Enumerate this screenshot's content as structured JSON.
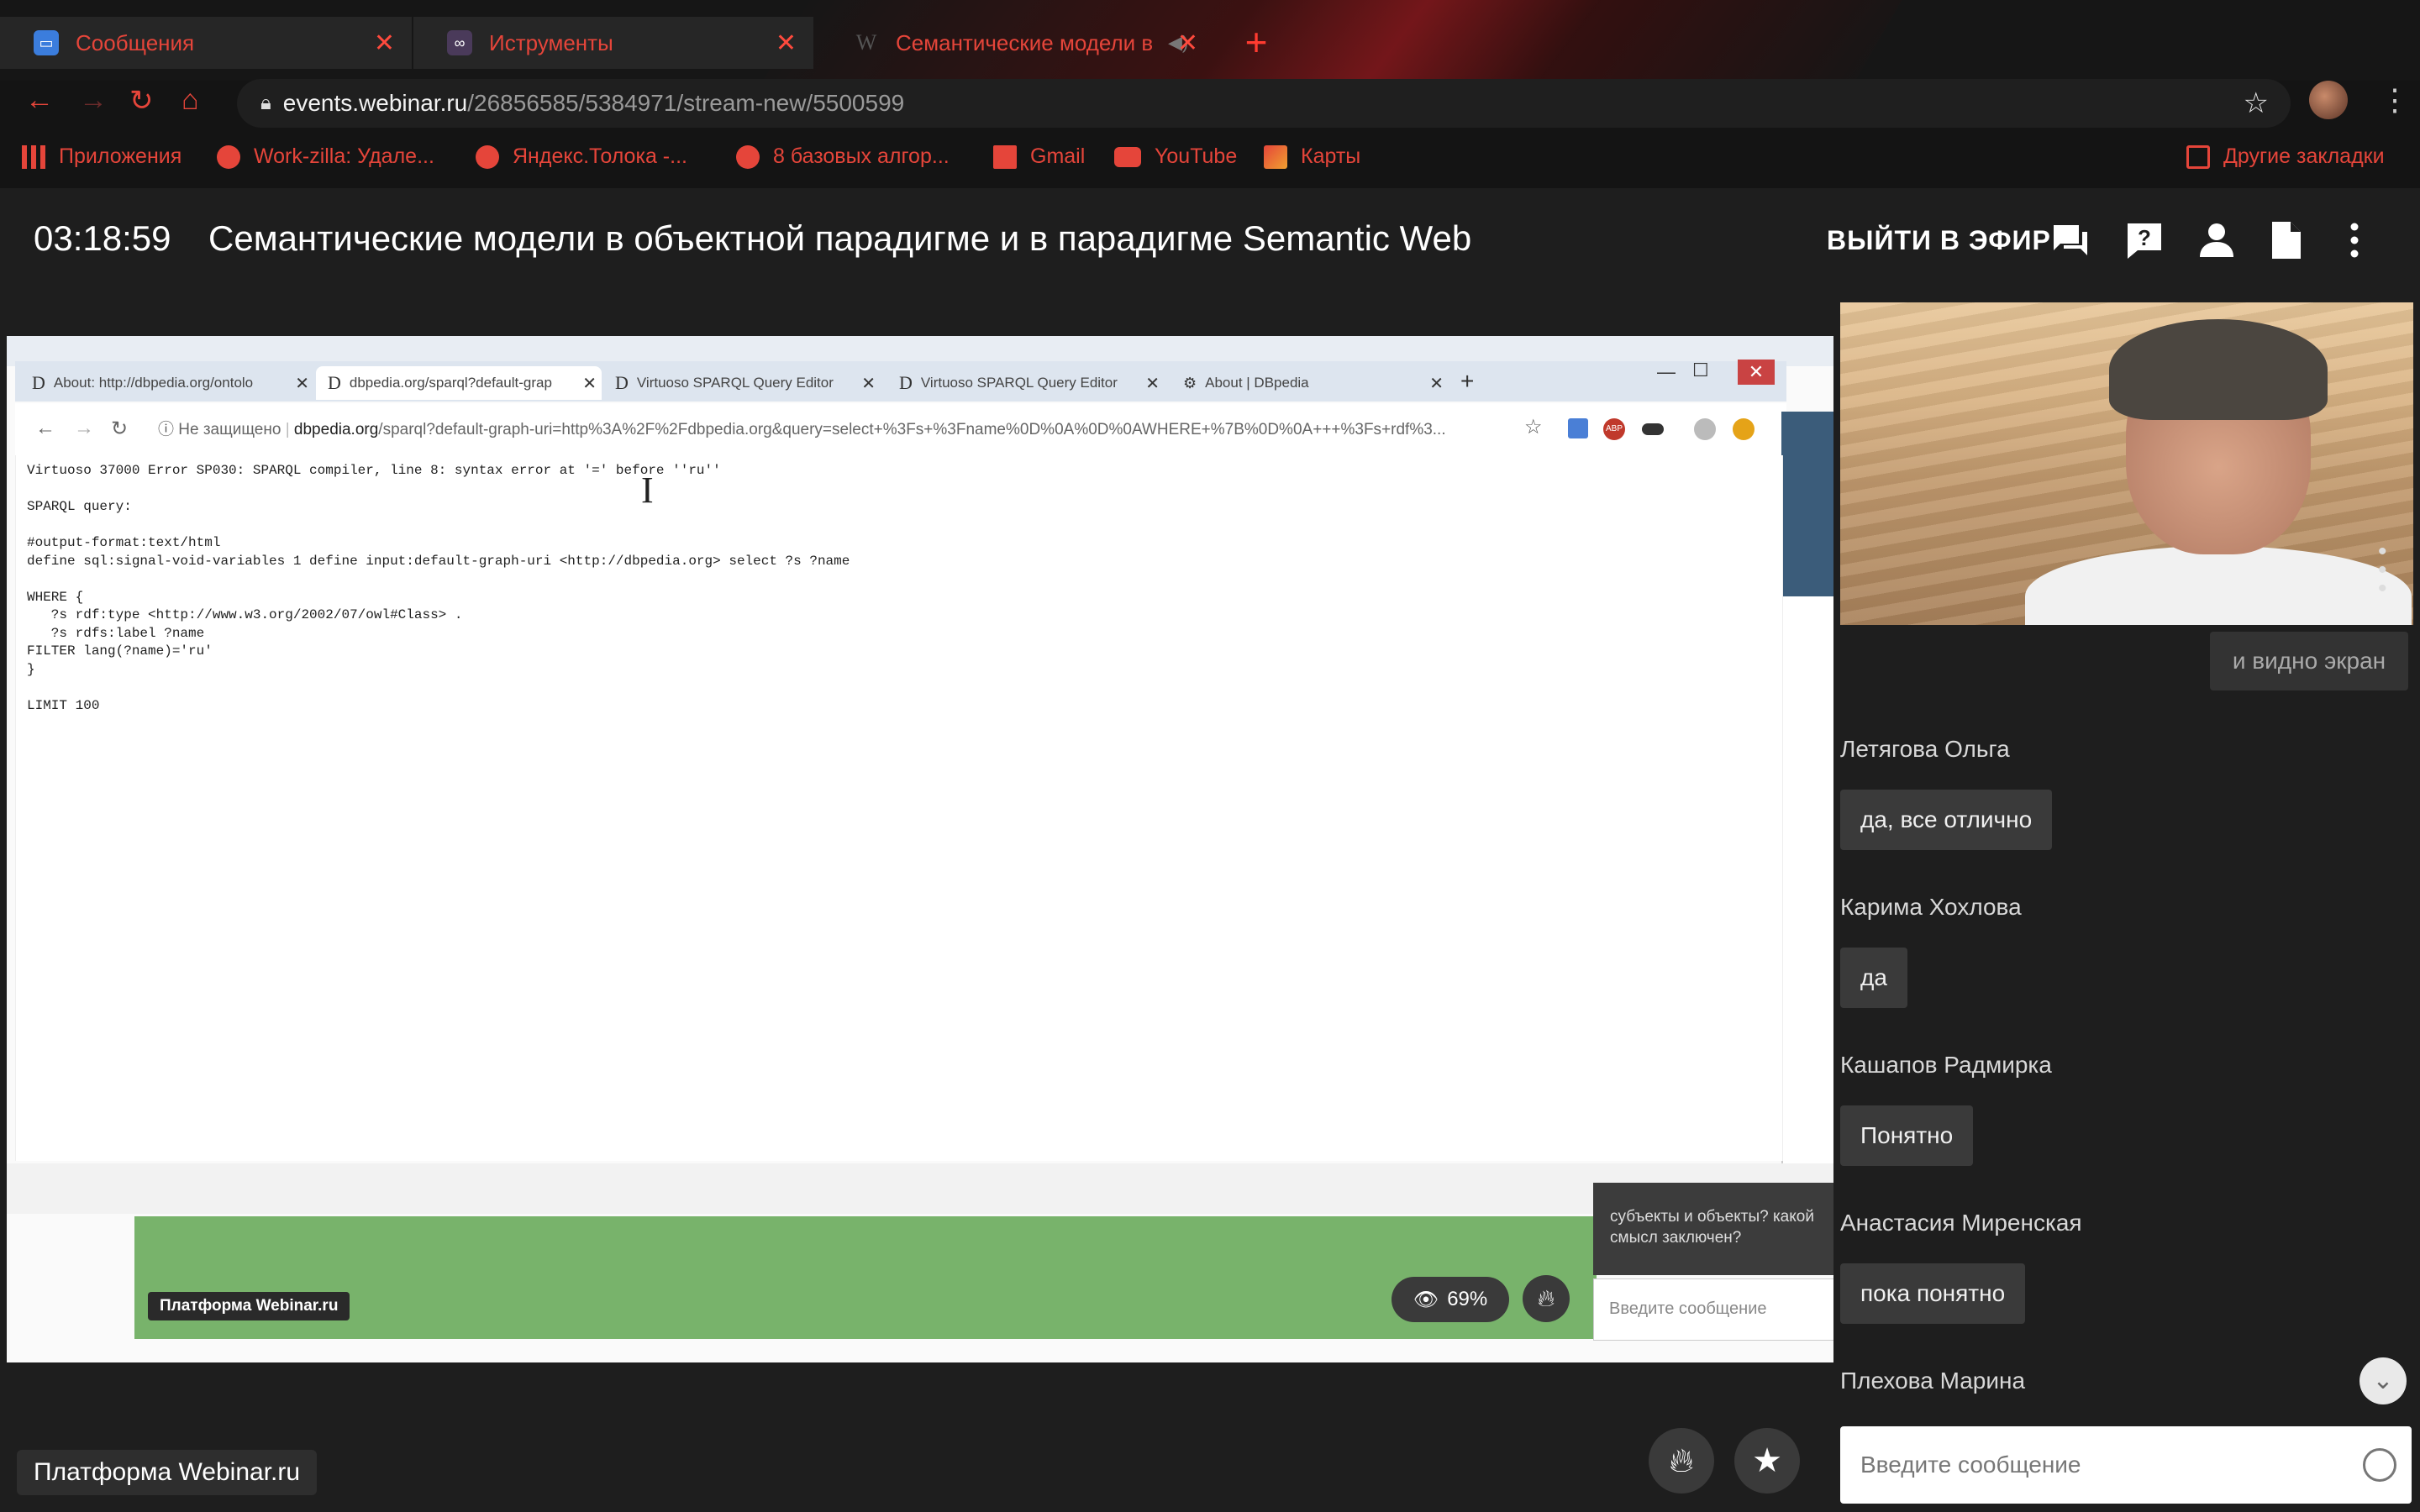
{
  "browser": {
    "tabs": [
      {
        "label": "Сообщения",
        "close": "✕"
      },
      {
        "label": "Иструменты",
        "close": "✕"
      },
      {
        "label": "Семантические модели в",
        "close": "✕"
      }
    ],
    "url_host": "events.webinar.ru",
    "url_path": "/26856585/5384971/stream-new/5500599",
    "bookmarks": [
      "Приложения",
      "Work-zilla: Удале...",
      "Яндекс.Толока -...",
      "8 базовых алгор...",
      "Gmail",
      "YouTube",
      "Карты"
    ],
    "other_bookmarks": "Другие закладки"
  },
  "header": {
    "timer": "03:18:59",
    "title": "Семантические модели в объектной парадигме и в парадигме Semantic Web",
    "go_live": "ВЫЙТИ В ЭФИР"
  },
  "shared_screen": {
    "tabs": [
      "About: http://dbpedia.org/ontolo",
      "dbpedia.org/sparql?default-grap",
      "Virtuoso SPARQL Query Editor",
      "Virtuoso SPARQL Query Editor",
      "About | DBpedia"
    ],
    "security": "Не защищено",
    "url_host": "dbpedia.org",
    "url_path": "/sparql?default-graph-uri=http%3A%2F%2Fdbpedia.org&query=select+%3Fs+%3Fname%0D%0A%0D%0AWHERE+%7B%0D%0A+++%3Fs+rdf%3...",
    "content": "Virtuoso 37000 Error SP030: SPARQL compiler, line 8: syntax error at '=' before ''ru''\n\nSPARQL query:\n\n#output-format:text/html\ndefine sql:signal-void-variables 1 define input:default-graph-uri <http://dbpedia.org> select ?s ?name\n\nWHERE {\n   ?s rdf:type <http://www.w3.org/2002/07/owl#Class> .\n   ?s rdfs:label ?name\nFILTER lang(?name)='ru'\n}\n\nLIMIT 100",
    "badge": "Платформа Webinar.ru",
    "views": "69%",
    "chat_msg": "субъекты и объекты? какой смысл заключен?",
    "chat_placeholder": "Введите сообщение"
  },
  "chat": {
    "previous_bubble": "и видно экран",
    "messages": [
      {
        "author": "Летягова Ольга",
        "text": "да, все отлично"
      },
      {
        "author": "Карима Хохлова",
        "text": "да"
      },
      {
        "author": "Кашапов Радмирка",
        "text": "Понятно"
      },
      {
        "author": "Анастасия Миренская",
        "text": "пока понятно"
      },
      {
        "author": "Плехова Марина",
        "text": ""
      }
    ],
    "input_placeholder": "Введите сообщение"
  },
  "footer": {
    "badge": "Платформа Webinar.ru"
  },
  "colors": {
    "accent": "#e5453a",
    "panel": "#1e1e1e",
    "bubble": "#3a3a3a"
  }
}
